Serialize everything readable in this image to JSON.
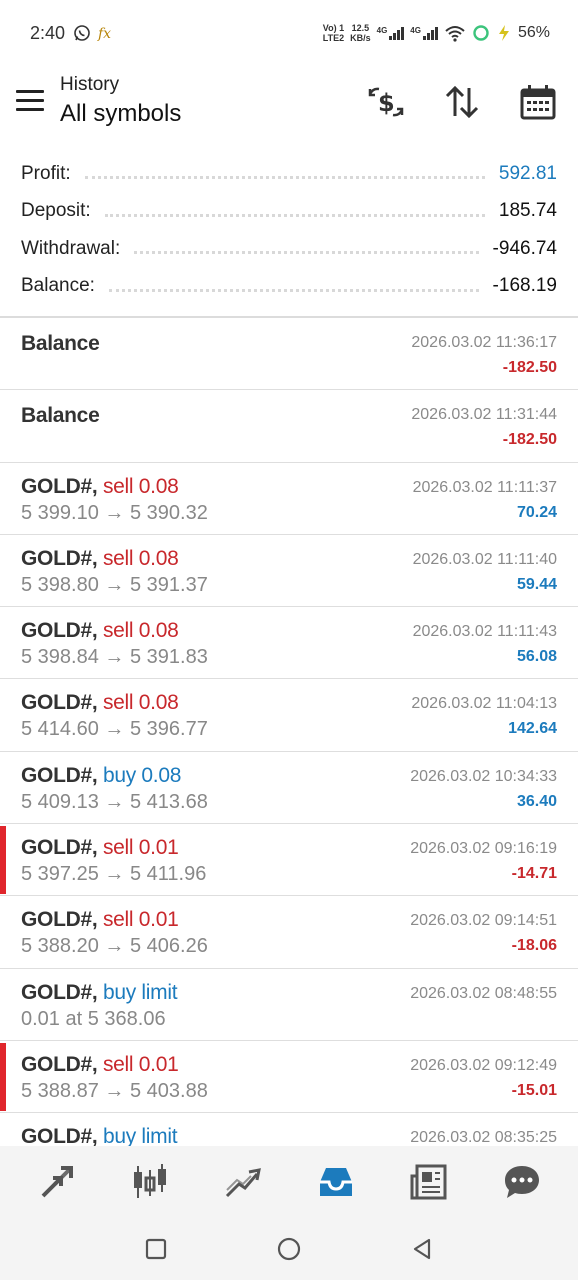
{
  "status_bar": {
    "time": "2:40",
    "carrier_top": "Vo) 1",
    "carrier_bottom": "LTE2",
    "speed_top": "12.5",
    "speed_bottom": "KB/s",
    "net1": "4G",
    "net2": "4G",
    "battery": "56%"
  },
  "header": {
    "subtitle": "History",
    "title": "All symbols"
  },
  "summary": [
    {
      "label": "Profit:",
      "value": "592.81",
      "color": "#1c7bbd"
    },
    {
      "label": "Deposit:",
      "value": "185.74"
    },
    {
      "label": "Withdrawal:",
      "value": "-946.74"
    },
    {
      "label": "Balance:",
      "value": "-168.19"
    }
  ],
  "rows": [
    {
      "symbol": "Balance",
      "action": "",
      "prices": "",
      "date": "2026.03.02 11:36:17",
      "profit": "-182.50",
      "profit_sign": "neg",
      "marked": false
    },
    {
      "symbol": "Balance",
      "action": "",
      "prices": "",
      "date": "2026.03.02 11:31:44",
      "profit": "-182.50",
      "profit_sign": "neg",
      "marked": false
    },
    {
      "symbol": "GOLD#,",
      "action": "sell 0.08",
      "action_type": "sell",
      "prices": "5 399.10 → 5 390.32",
      "date": "2026.03.02 11:11:37",
      "profit": "70.24",
      "profit_sign": "pos",
      "marked": false
    },
    {
      "symbol": "GOLD#,",
      "action": "sell 0.08",
      "action_type": "sell",
      "prices": "5 398.80 → 5 391.37",
      "date": "2026.03.02 11:11:40",
      "profit": "59.44",
      "profit_sign": "pos",
      "marked": false
    },
    {
      "symbol": "GOLD#,",
      "action": "sell 0.08",
      "action_type": "sell",
      "prices": "5 398.84 → 5 391.83",
      "date": "2026.03.02 11:11:43",
      "profit": "56.08",
      "profit_sign": "pos",
      "marked": false
    },
    {
      "symbol": "GOLD#,",
      "action": "sell 0.08",
      "action_type": "sell",
      "prices": "5 414.60 → 5 396.77",
      "date": "2026.03.02 11:04:13",
      "profit": "142.64",
      "profit_sign": "pos",
      "marked": false
    },
    {
      "symbol": "GOLD#,",
      "action": "buy 0.08",
      "action_type": "buy",
      "prices": "5 409.13 → 5 413.68",
      "date": "2026.03.02 10:34:33",
      "profit": "36.40",
      "profit_sign": "pos",
      "marked": false
    },
    {
      "symbol": "GOLD#,",
      "action": "sell 0.01",
      "action_type": "sell",
      "prices": "5 397.25 → 5 411.96",
      "date": "2026.03.02 09:16:19",
      "profit": "-14.71",
      "profit_sign": "neg",
      "marked": true
    },
    {
      "symbol": "GOLD#,",
      "action": "sell 0.01",
      "action_type": "sell",
      "prices": "5 388.20 → 5 406.26",
      "date": "2026.03.02 09:14:51",
      "profit": "-18.06",
      "profit_sign": "neg",
      "marked": false
    },
    {
      "symbol": "GOLD#,",
      "action": "buy limit",
      "action_type": "buy",
      "prices": "0.01 at 5 368.06",
      "date": "2026.03.02 08:48:55",
      "profit": "",
      "profit_sign": "pos",
      "marked": false
    },
    {
      "symbol": "GOLD#,",
      "action": "sell 0.01",
      "action_type": "sell",
      "prices": "5 388.87 → 5 403.88",
      "date": "2026.03.02 09:12:49",
      "profit": "-15.01",
      "profit_sign": "neg",
      "marked": true
    },
    {
      "symbol": "GOLD#,",
      "action": "buy limit",
      "action_type": "buy",
      "prices": "",
      "date": "2026.03.02 08:35:25",
      "profit": "",
      "profit_sign": "pos",
      "marked": false
    }
  ],
  "bottom_nav": [
    {
      "icon": "quotes-icon",
      "active": false
    },
    {
      "icon": "chart-icon",
      "active": false
    },
    {
      "icon": "trade-icon",
      "active": false
    },
    {
      "icon": "history-icon",
      "active": true
    },
    {
      "icon": "news-icon",
      "active": false
    },
    {
      "icon": "chat-icon",
      "active": false
    }
  ],
  "colors": {
    "accent": "#1c7bbd",
    "sell": "#c8282c",
    "inactive_icon": "#555555"
  }
}
